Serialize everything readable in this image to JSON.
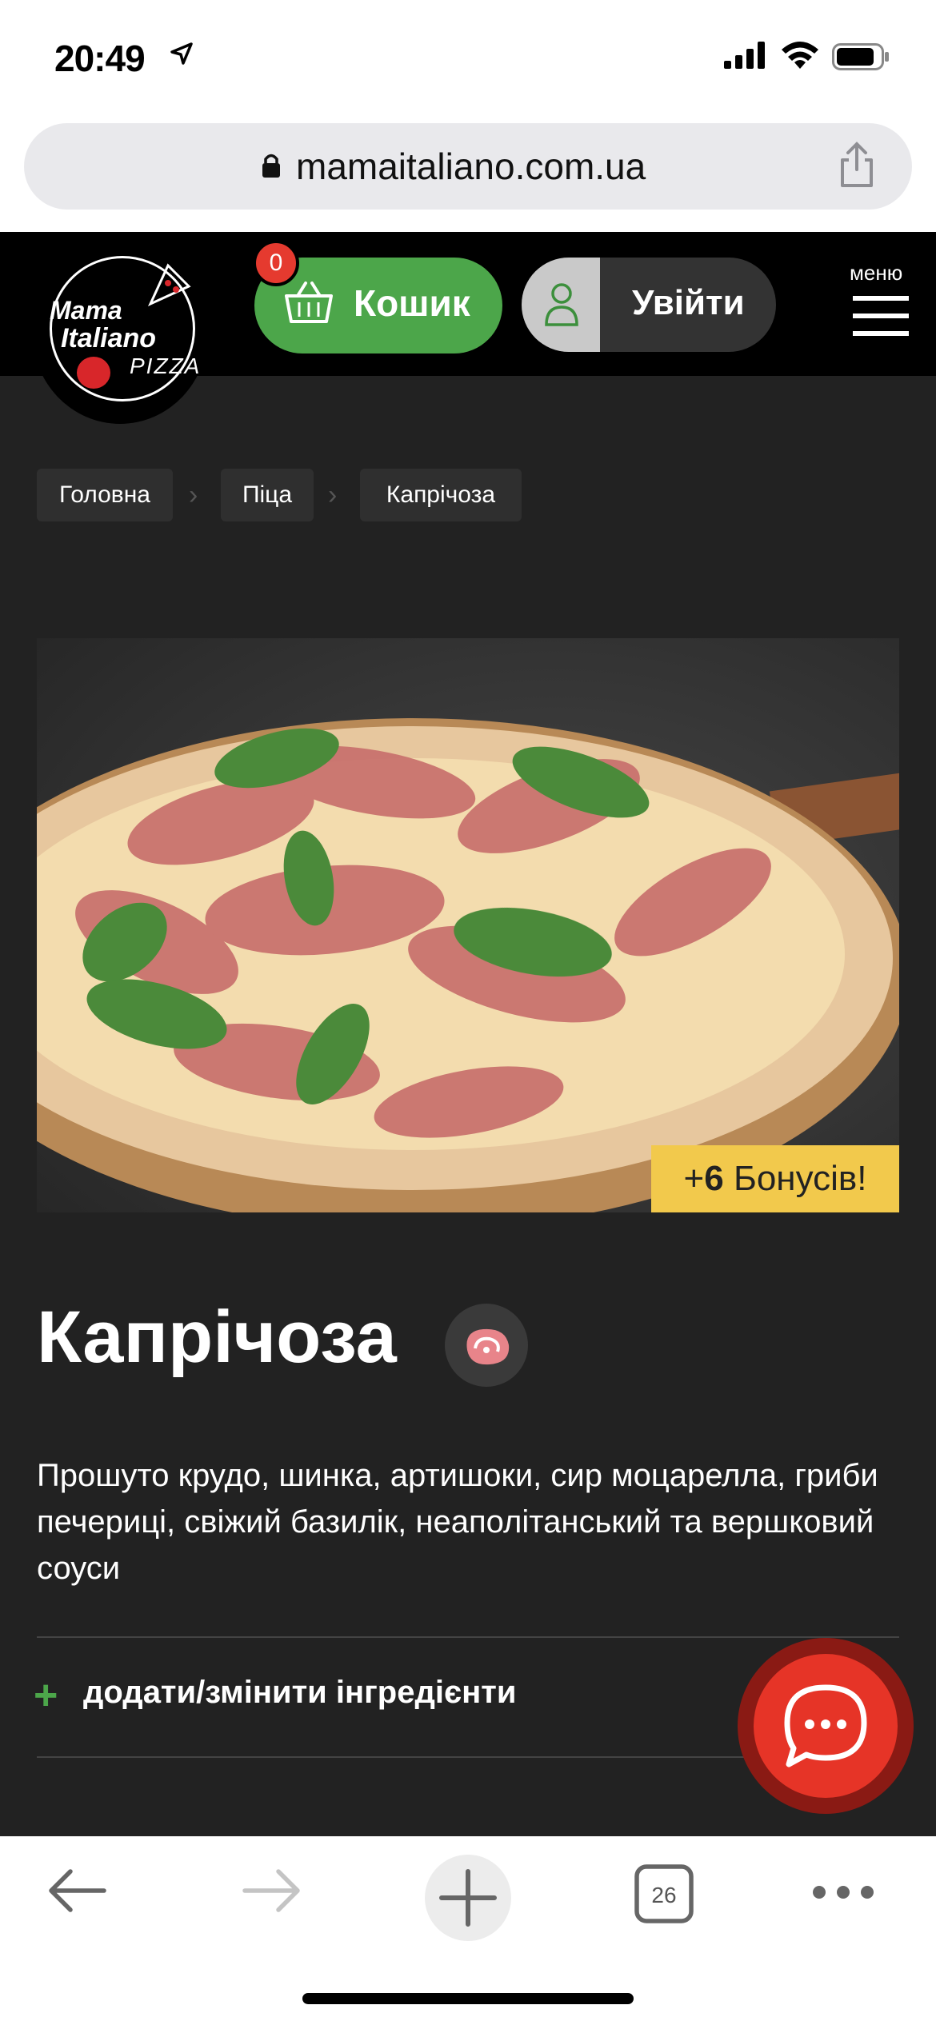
{
  "status_bar": {
    "time": "20:49"
  },
  "browser": {
    "url": "mamaitaliano.com.ua",
    "tab_count": "26"
  },
  "header": {
    "logo": {
      "line1": "Mama",
      "line2": "Italiano",
      "line3": "PIZZA"
    },
    "cart": {
      "label": "Кошик",
      "count": "0"
    },
    "login": {
      "label": "Увійти"
    },
    "menu": {
      "label": "меню"
    }
  },
  "breadcrumbs": [
    {
      "label": "Головна"
    },
    {
      "label": "Піца"
    },
    {
      "label": "Капрічоза"
    }
  ],
  "product": {
    "bonus_prefix": "+",
    "bonus_value": "6",
    "bonus_label": "Бонусів!",
    "title": "Капрічоза",
    "description": "Прошуто крудо, шинка, артишоки, сир моцарелла, гриби печериці, свіжий базилік, неаполітанський та вершковий соуси",
    "ingredients_toggle": "додати/змінити інгредієнти",
    "icons": {
      "category": "meat-icon"
    }
  },
  "colors": {
    "accent_green": "#4ca64a",
    "accent_red": "#e53a2f",
    "bonus_yellow": "#f2c94c",
    "page_bg": "#222222"
  }
}
